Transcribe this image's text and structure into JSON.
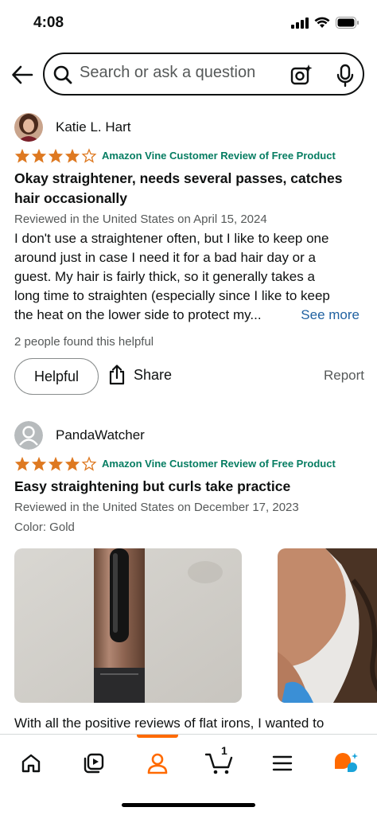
{
  "status_bar": {
    "time": "4:08"
  },
  "search": {
    "placeholder": "Search or ask a question"
  },
  "reviews": [
    {
      "reviewer_name": "Katie L. Hart",
      "rating": 4,
      "vine_label": "Amazon Vine Customer Review of Free Product",
      "title_line1": "Okay straightener, needs several passes, catches",
      "title_line2": "hair occasionally",
      "meta": "Reviewed in the United States on April 15, 2024",
      "body_lines": [
        "I don't use a straightener often, but I like to keep one",
        "around just in case I need it for a bad hair day or a",
        "guest. My hair is fairly thick, so it generally takes a",
        "long time to straighten (especially since I like to keep",
        "the heat on the lower side to protect my..."
      ],
      "see_more": "See more",
      "helpful_count": "2 people found this helpful",
      "helpful_label": "Helpful",
      "share_label": "Share",
      "report_label": "Report"
    },
    {
      "reviewer_name": "PandaWatcher",
      "rating": 4,
      "vine_label": "Amazon Vine Customer Review of Free Product",
      "title": "Easy straightening but curls take practice",
      "meta": "Reviewed in the United States on December 17, 2023",
      "color": "Color: Gold",
      "body_snippet": "With all the positive reviews of flat irons, I wanted to"
    }
  ],
  "tab_bar": {
    "active_tab": "account",
    "cart_count": "1",
    "tabs": [
      "home",
      "video",
      "account",
      "cart",
      "menu",
      "rufus"
    ]
  },
  "colors": {
    "star": "#de7921",
    "vine": "#067d62",
    "link": "#2162a1",
    "accent": "#ff6a00"
  }
}
